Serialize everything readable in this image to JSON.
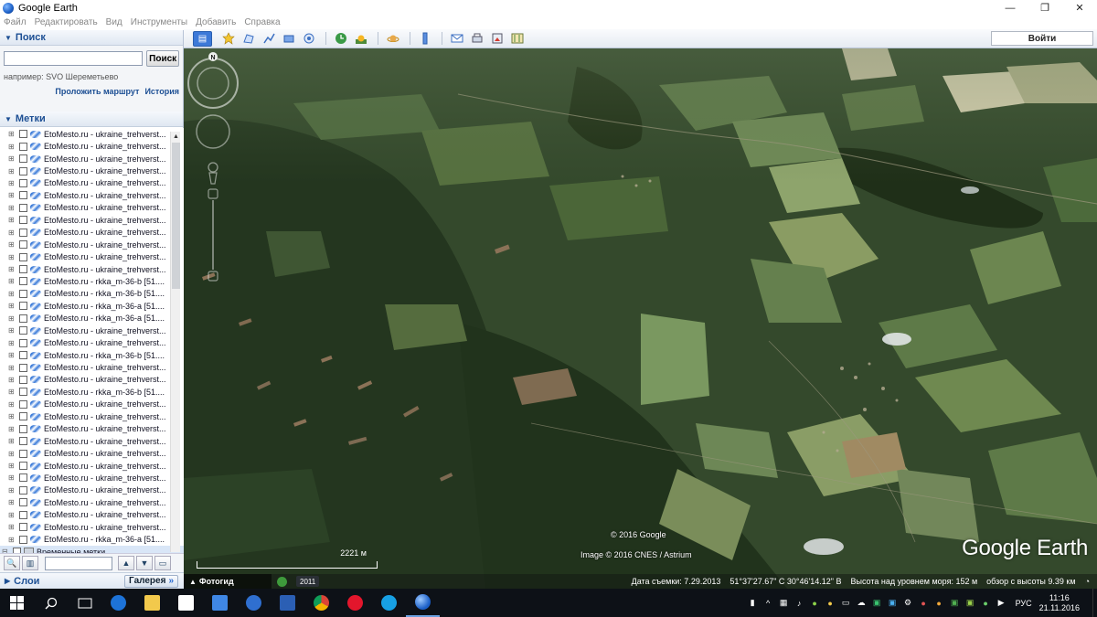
{
  "window": {
    "title": "Google Earth",
    "controls": [
      "—",
      "❐",
      "✕"
    ]
  },
  "menu": [
    "Файл",
    "Редактировать",
    "Вид",
    "Инструменты",
    "Добавить",
    "Справка"
  ],
  "search": {
    "header": "Поиск",
    "input_value": "",
    "button": "Поиск",
    "hint": "например: SVO Шереметьево",
    "route_link": "Проложить маршрут",
    "history_link": "История"
  },
  "places": {
    "header": "Метки",
    "items": [
      "EtoMesto.ru - ukraine_trehverst...",
      "EtoMesto.ru - ukraine_trehverst...",
      "EtoMesto.ru - ukraine_trehverst...",
      "EtoMesto.ru - ukraine_trehverst...",
      "EtoMesto.ru - ukraine_trehverst...",
      "EtoMesto.ru - ukraine_trehverst...",
      "EtoMesto.ru - ukraine_trehverst...",
      "EtoMesto.ru - ukraine_trehverst...",
      "EtoMesto.ru - ukraine_trehverst...",
      "EtoMesto.ru - ukraine_trehverst...",
      "EtoMesto.ru - ukraine_trehverst...",
      "EtoMesto.ru - ukraine_trehverst...",
      "EtoMesto.ru - rkka_m-36-b [51....",
      "EtoMesto.ru - rkka_m-36-b [51....",
      "EtoMesto.ru - rkka_m-36-a [51....",
      "EtoMesto.ru - rkka_m-36-a [51....",
      "EtoMesto.ru - ukraine_trehverst...",
      "EtoMesto.ru - ukraine_trehverst...",
      "EtoMesto.ru - rkka_m-36-b [51....",
      "EtoMesto.ru - ukraine_trehverst...",
      "EtoMesto.ru - ukraine_trehverst...",
      "EtoMesto.ru - rkka_m-36-b [51....",
      "EtoMesto.ru - ukraine_trehverst...",
      "EtoMesto.ru - ukraine_trehverst...",
      "EtoMesto.ru - ukraine_trehverst...",
      "EtoMesto.ru - ukraine_trehverst...",
      "EtoMesto.ru - ukraine_trehverst...",
      "EtoMesto.ru - ukraine_trehverst...",
      "EtoMesto.ru - ukraine_trehverst...",
      "EtoMesto.ru - ukraine_trehverst...",
      "EtoMesto.ru - ukraine_trehverst...",
      "EtoMesto.ru - ukraine_trehverst...",
      "EtoMesto.ru - ukraine_trehverst...",
      "EtoMesto.ru - rkka_m-36-a [51...."
    ],
    "temp_folder": "Временные метки",
    "temp_item": "EtoMesto.ru - ukraine_trehverst..."
  },
  "layers": {
    "label": "Слои",
    "gallery": "Галерея",
    "gallery_arrow": "»"
  },
  "toolbar": {
    "login": "Войти"
  },
  "map": {
    "copyright": "© 2016 Google",
    "image_credit": "Image © 2016 CNES / Astrium",
    "logo": "Google Earth",
    "scale_label": "2221 м",
    "compass_north": "N",
    "tour_tab": "Фотогид",
    "year": "2011",
    "date_label": "Дата съемки: 7.29.2013",
    "coords": "51°37'27.67\" С   30°46'14.12\" В",
    "elevation": "Высота над уровнем моря:   152 м",
    "eye_alt": "обзор с высоты   9.39 км"
  },
  "taskbar": {
    "lang": "РУС",
    "time": "11:16",
    "date": "21.11.2016"
  }
}
